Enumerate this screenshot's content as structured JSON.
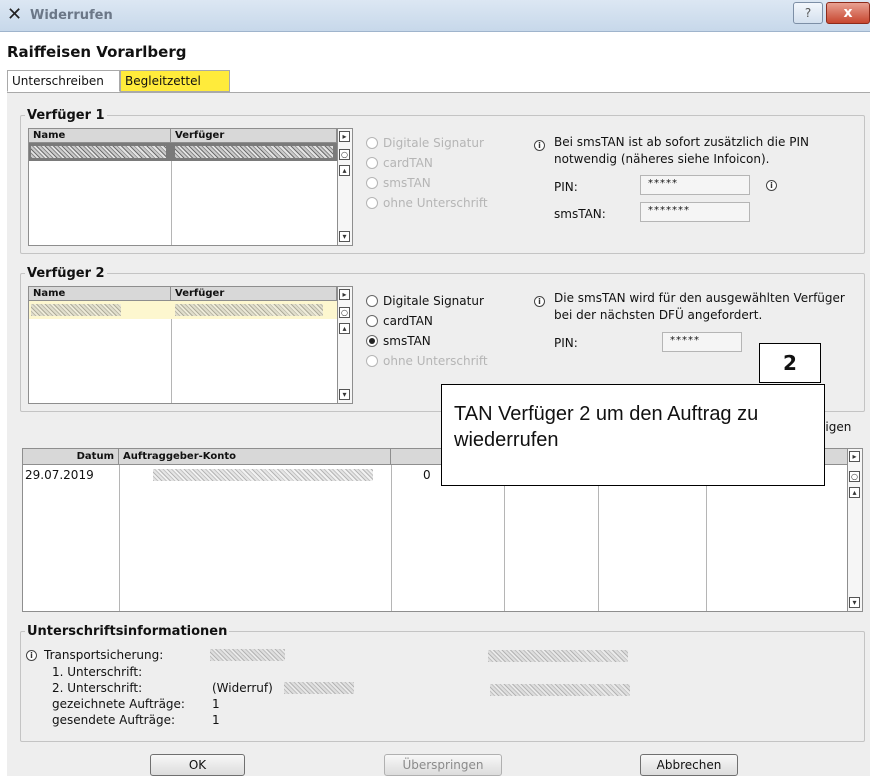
{
  "window": {
    "title": "Widerrufen",
    "help_glyph": "?",
    "close_glyph": "x"
  },
  "bank": "Raiffeisen Vorarlberg",
  "tabs": [
    {
      "label": "Unterschreiben",
      "active": true
    },
    {
      "label": "Begleitzettel",
      "highlight": "#ffeb3b"
    }
  ],
  "verfueger1": {
    "legend": "Verfüger 1",
    "columns": [
      "Name",
      "Verfüger"
    ],
    "options": [
      "Digitale Signatur",
      "cardTAN",
      "smsTAN",
      "ohne Unterschrift"
    ],
    "info": "Bei smsTAN ist ab sofort zusätzlich die PIN notwendig (näheres siehe Infoicon).",
    "pin_label": "PIN:",
    "pin_value": "*****",
    "smstan_label": "smsTAN:",
    "smstan_value": "*******"
  },
  "verfueger2": {
    "legend": "Verfüger 2",
    "columns": [
      "Name",
      "Verfüger"
    ],
    "options": [
      "Digitale Signatur",
      "cardTAN",
      "smsTAN",
      "ohne Unterschrift"
    ],
    "selected_option": "smsTAN",
    "info": "Die smsTAN wird für den ausgewählten Verfüger bei der nächsten DFÜ angefordert.",
    "pin_label": "PIN:",
    "pin_value": "*****"
  },
  "callout": {
    "number": "2",
    "text": "TAN Verfüger 2  um den Auftrag zu wiederrufen"
  },
  "orders": {
    "partial_link": "eigen",
    "columns": [
      "Datum",
      "Auftraggeber-Konto"
    ],
    "rows": [
      {
        "datum": "29.07.2019",
        "partial_value": "0"
      }
    ]
  },
  "signature_info": {
    "legend": "Unterschriftsinformationen",
    "transport_label": "Transportsicherung:",
    "first_label": "1. Unterschrift:",
    "second_label": "2. Unterschrift:",
    "second_value": "(Widerruf)",
    "signed_label": "gezeichnete Aufträge:",
    "signed_value": "1",
    "sent_label": "gesendete Aufträge:",
    "sent_value": "1"
  },
  "buttons": {
    "ok": "OK",
    "skip": "Überspringen",
    "cancel": "Abbrechen"
  }
}
